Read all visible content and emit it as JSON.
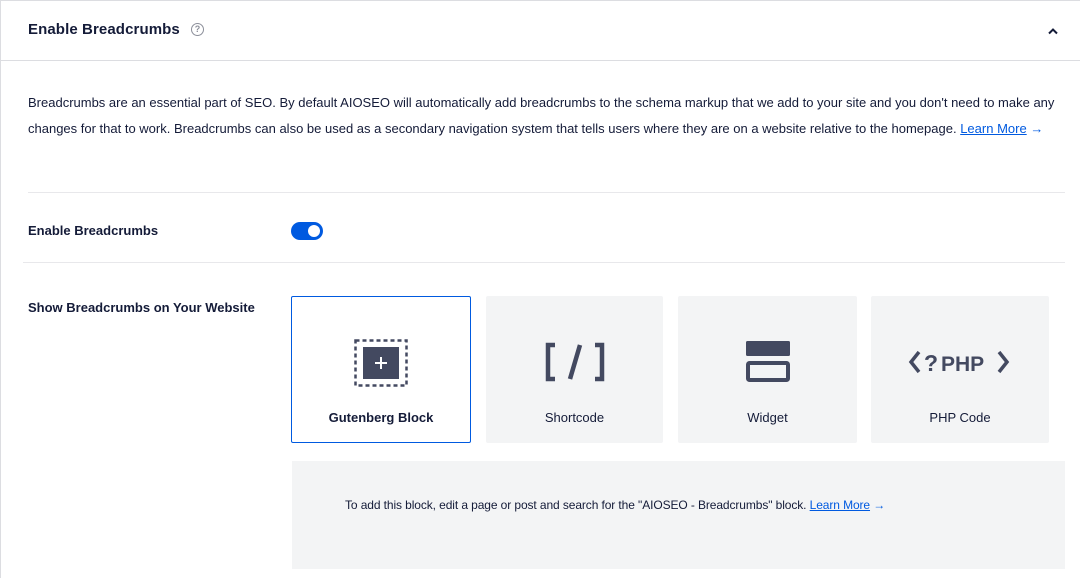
{
  "header": {
    "title": "Enable Breadcrumbs",
    "help_icon": "question-circle-icon",
    "collapse_icon": "chevron-up-icon"
  },
  "description": {
    "text": "Breadcrumbs are an essential part of SEO. By default AIOSEO will automatically add breadcrumbs to the schema markup that we add to your site and you don't need to make any changes for that to work. Breadcrumbs can also be used as a secondary navigation system that tells users where they are on a website relative to the homepage.",
    "link_label": "Learn More",
    "arrow": "→"
  },
  "enable_row": {
    "label": "Enable Breadcrumbs",
    "toggle_on": true
  },
  "display_row": {
    "label": "Show Breadcrumbs on Your Website",
    "options": [
      {
        "label": "Gutenberg Block",
        "icon": "gutenberg-block-icon",
        "selected": true
      },
      {
        "label": "Shortcode",
        "icon": "shortcode-icon",
        "selected": false
      },
      {
        "label": "Widget",
        "icon": "widget-icon",
        "selected": false
      },
      {
        "label": "PHP Code",
        "icon": "php-code-icon",
        "selected": false
      }
    ]
  },
  "info": {
    "text": "To add this block, edit a page or post and search for the \"AIOSEO - Breadcrumbs\" block.",
    "link_label": "Learn More",
    "arrow": "→"
  },
  "colors": {
    "accent": "#005ae0",
    "text": "#141b38",
    "card_bg": "#f3f4f5",
    "icon_dark": "#434960"
  }
}
